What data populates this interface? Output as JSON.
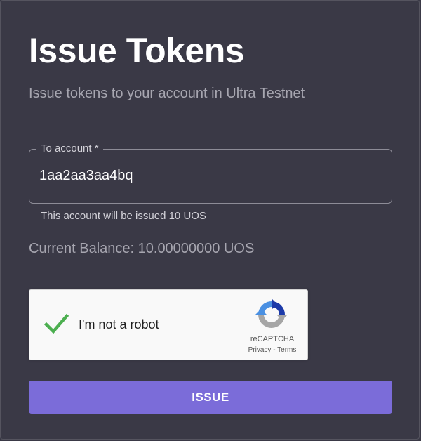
{
  "page": {
    "title": "Issue Tokens",
    "subtitle": "Issue tokens to your account in Ultra Testnet"
  },
  "form": {
    "account_label": "To account *",
    "account_value": "1aa2aa3aa4bq",
    "helper_text": "This account will be issued 10 UOS",
    "balance_text": "Current Balance: 10.00000000 UOS"
  },
  "captcha": {
    "label": "I'm not a robot",
    "checked": true,
    "brand": "reCAPTCHA",
    "privacy_link": "Privacy",
    "separator": " - ",
    "terms_link": "Terms",
    "check_icon": "checkmark-icon",
    "logo_icon": "recaptcha-logo-icon"
  },
  "actions": {
    "issue_label": "ISSUE"
  },
  "colors": {
    "background": "#3a3946",
    "accent": "#7b6cd9",
    "check_green": "#4caf50"
  }
}
